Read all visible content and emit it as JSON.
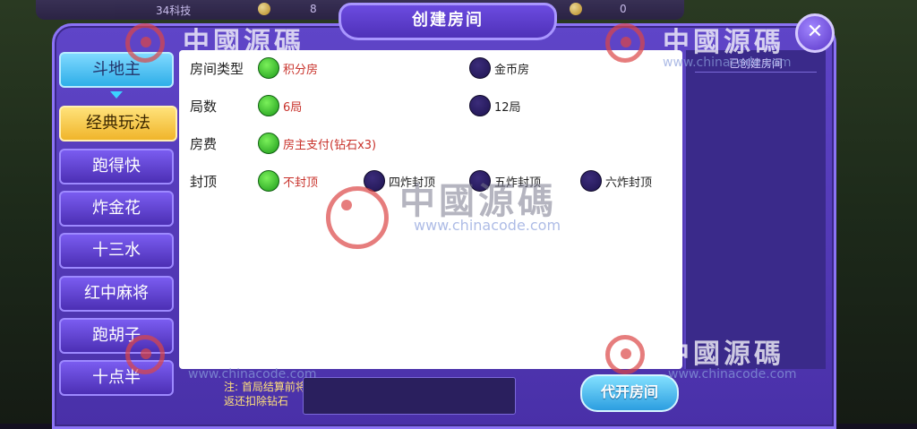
{
  "topbar": {
    "stat1": "34科技",
    "stat2": "8",
    "stat3": "0"
  },
  "dialog": {
    "title": "创建房间",
    "close_label": "✕"
  },
  "nav": {
    "game_type": "斗地主",
    "items": [
      "经典玩法",
      "跑得快",
      "炸金花",
      "十三水",
      "红中麻将",
      "跑胡子",
      "十点半"
    ]
  },
  "rows": [
    {
      "label": "房间类型",
      "options": [
        {
          "text": "积分房",
          "selected": true
        },
        {
          "text": "金币房",
          "selected": false
        }
      ]
    },
    {
      "label": "局数",
      "options": [
        {
          "text": "6局",
          "selected": true
        },
        {
          "text": "12局",
          "selected": false
        }
      ]
    },
    {
      "label": "房费",
      "options": [
        {
          "text": "房主支付(钻石x3)",
          "selected": true
        }
      ]
    },
    {
      "label": "封顶",
      "options": [
        {
          "text": "不封顶",
          "selected": true
        },
        {
          "text": "四炸封顶",
          "selected": false
        },
        {
          "text": "五炸封顶",
          "selected": false
        },
        {
          "text": "六炸封顶",
          "selected": false
        }
      ]
    }
  ],
  "right_panel": {
    "title": "已创建房间"
  },
  "footer": {
    "note_line1": "注: 首局结算前将",
    "note_line2": "返还扣除钻石",
    "open_button": "代开房间"
  },
  "watermark": {
    "text": "中國源碼",
    "url": "www.chinacode.com"
  },
  "colors": {
    "selected_radio": "#2fb82a",
    "unselected_radio": "#221655",
    "accent_text": "#c8322b",
    "panel_bg": "#5f45c8"
  }
}
